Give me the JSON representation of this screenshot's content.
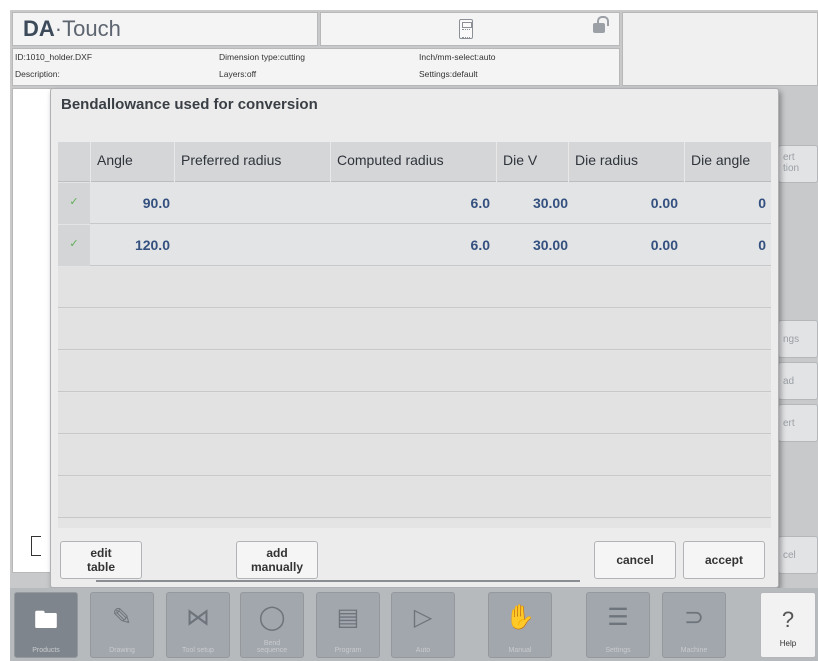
{
  "header": {
    "logo_bold": "DA",
    "logo_rest": "·Touch"
  },
  "info": {
    "id": "ID:1010_holder.DXF",
    "description": "Description:",
    "dimension_type": "Dimension type:cutting",
    "layers": "Layers:off",
    "inch_mm": "Inch/mm-select:auto",
    "settings": "Settings:default"
  },
  "right_buttons": [
    "ert\ntion",
    "ngs",
    "ad",
    "ert",
    "cel"
  ],
  "dialog": {
    "title": "Bendallowance used for conversion",
    "columns": [
      "Angle",
      "Preferred radius",
      "Computed radius",
      "Die V",
      "Die radius",
      "Die angle"
    ],
    "rows": [
      {
        "angle": "90.0",
        "preferred_radius": "",
        "computed_radius": "6.0",
        "die_v": "30.00",
        "die_radius": "0.00",
        "die_angle": "0"
      },
      {
        "angle": "120.0",
        "preferred_radius": "",
        "computed_radius": "6.0",
        "die_v": "30.00",
        "die_radius": "0.00",
        "die_angle": "0"
      }
    ],
    "buttons": {
      "edit_table": [
        "edit",
        "table"
      ],
      "add_manually": [
        "add",
        "manually"
      ],
      "cancel": "cancel",
      "accept": "accept"
    }
  },
  "nav": [
    {
      "label": "Products",
      "icon": "folder-icon"
    },
    {
      "label": "Drawing",
      "icon": "drawing-icon"
    },
    {
      "label": "Tool setup",
      "icon": "tool-setup-icon"
    },
    {
      "label": "Bend\nsequence",
      "icon": "bend-sequence-icon"
    },
    {
      "label": "Program",
      "icon": "program-icon"
    },
    {
      "label": "Auto",
      "icon": "play-icon"
    },
    {
      "label": "Manual",
      "icon": "hand-icon"
    },
    {
      "label": "Settings",
      "icon": "settings-icon"
    },
    {
      "label": "Machine",
      "icon": "machine-icon"
    }
  ],
  "help": {
    "symbol": "?",
    "label": "Help"
  }
}
